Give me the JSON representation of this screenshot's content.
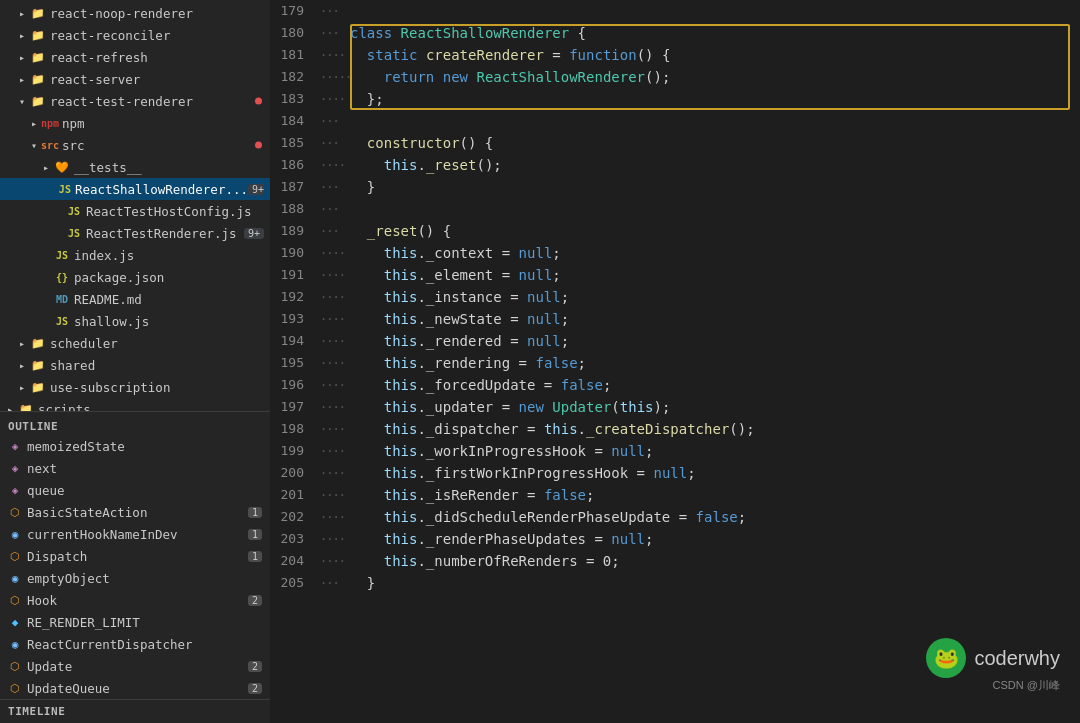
{
  "sidebar": {
    "file_tree": [
      {
        "id": "react-noop-renderer",
        "label": "react-noop-renderer",
        "indent": 1,
        "type": "folder",
        "state": "closed"
      },
      {
        "id": "react-reconciler",
        "label": "react-reconciler",
        "indent": 1,
        "type": "folder",
        "state": "closed"
      },
      {
        "id": "react-refresh",
        "label": "react-refresh",
        "indent": 1,
        "type": "folder",
        "state": "closed"
      },
      {
        "id": "react-server",
        "label": "react-server",
        "indent": 1,
        "type": "folder",
        "state": "closed"
      },
      {
        "id": "react-test-renderer",
        "label": "react-test-renderer",
        "indent": 1,
        "type": "folder",
        "state": "open",
        "dot": true
      },
      {
        "id": "npm",
        "label": "npm",
        "indent": 2,
        "type": "npm",
        "state": "closed"
      },
      {
        "id": "src",
        "label": "src",
        "indent": 2,
        "type": "src",
        "state": "open",
        "dot": true
      },
      {
        "id": "__tests__",
        "label": "__tests__",
        "indent": 3,
        "type": "test",
        "state": "closed"
      },
      {
        "id": "ReactShallowRenderer",
        "label": "ReactShallowRenderer...",
        "indent": 4,
        "type": "js",
        "state": "file",
        "badge": "9+",
        "active": true
      },
      {
        "id": "ReactTestHostConfig",
        "label": "ReactTestHostConfig.js",
        "indent": 4,
        "type": "js",
        "state": "file"
      },
      {
        "id": "ReactTestRenderer",
        "label": "ReactTestRenderer.js",
        "indent": 4,
        "type": "js",
        "state": "file",
        "badge": "9+"
      },
      {
        "id": "index.js",
        "label": "index.js",
        "indent": 3,
        "type": "js",
        "state": "file"
      },
      {
        "id": "package.json",
        "label": "package.json",
        "indent": 3,
        "type": "json",
        "state": "file"
      },
      {
        "id": "README.md",
        "label": "README.md",
        "indent": 3,
        "type": "md",
        "state": "file"
      },
      {
        "id": "shallow.js",
        "label": "shallow.js",
        "indent": 3,
        "type": "js",
        "state": "file"
      },
      {
        "id": "scheduler",
        "label": "scheduler",
        "indent": 1,
        "type": "folder",
        "state": "closed"
      },
      {
        "id": "shared",
        "label": "shared",
        "indent": 1,
        "type": "folder",
        "state": "closed"
      },
      {
        "id": "use-subscription",
        "label": "use-subscription",
        "indent": 1,
        "type": "folder",
        "state": "closed"
      },
      {
        "id": "scripts",
        "label": "scripts",
        "indent": 0,
        "type": "folder",
        "state": "closed"
      }
    ],
    "outline_label": "OUTLINE",
    "outline_items": [
      {
        "id": "memoizedState",
        "label": "memoizedState",
        "icon": "property"
      },
      {
        "id": "next",
        "label": "next",
        "icon": "property"
      },
      {
        "id": "queue",
        "label": "queue",
        "icon": "property"
      },
      {
        "id": "BasicStateAction",
        "label": "BasicStateAction",
        "icon": "class",
        "badge": "1"
      },
      {
        "id": "currentHookNameInDev",
        "label": "currentHookNameInDev",
        "icon": "var",
        "badge": "1"
      },
      {
        "id": "Dispatch",
        "label": "Dispatch",
        "icon": "class",
        "badge": "1"
      },
      {
        "id": "emptyObject",
        "label": "emptyObject",
        "icon": "var"
      },
      {
        "id": "Hook",
        "label": "Hook",
        "icon": "class",
        "badge": "2"
      },
      {
        "id": "RE_RENDER_LIMIT",
        "label": "RE_RENDER_LIMIT",
        "icon": "const"
      },
      {
        "id": "ReactCurrentDispatcher",
        "label": "ReactCurrentDispatcher",
        "icon": "var"
      },
      {
        "id": "Update",
        "label": "Update",
        "icon": "class",
        "badge": "2"
      },
      {
        "id": "UpdateQueue",
        "label": "UpdateQueue",
        "icon": "class",
        "badge": "2"
      }
    ],
    "timeline_label": "TIMELINE"
  },
  "code": {
    "lines": [
      {
        "num": 179,
        "dots": "···",
        "content": ""
      },
      {
        "num": 180,
        "dots": "···",
        "content": "class ReactShallowRenderer {",
        "highlight_start": true
      },
      {
        "num": 181,
        "dots": "····",
        "content": "  static createRenderer = function() {",
        "highlight": true
      },
      {
        "num": 182,
        "dots": "·····",
        "content": "    return new ReactShallowRenderer();",
        "highlight": true
      },
      {
        "num": 183,
        "dots": "····",
        "content": "  };",
        "highlight_end": true
      },
      {
        "num": 184,
        "dots": "···",
        "content": ""
      },
      {
        "num": 185,
        "dots": "···",
        "content": "  constructor() {"
      },
      {
        "num": 186,
        "dots": "····",
        "content": "    this._reset();"
      },
      {
        "num": 187,
        "dots": "···",
        "content": "  }"
      },
      {
        "num": 188,
        "dots": "···",
        "content": ""
      },
      {
        "num": 189,
        "dots": "···",
        "content": "  _reset() {"
      },
      {
        "num": 190,
        "dots": "····",
        "content": "    this._context = null;"
      },
      {
        "num": 191,
        "dots": "····",
        "content": "    this._element = null;"
      },
      {
        "num": 192,
        "dots": "····",
        "content": "    this._instance = null;"
      },
      {
        "num": 193,
        "dots": "····",
        "content": "    this._newState = null;"
      },
      {
        "num": 194,
        "dots": "····",
        "content": "    this._rendered = null;"
      },
      {
        "num": 195,
        "dots": "····",
        "content": "    this._rendering = false;"
      },
      {
        "num": 196,
        "dots": "····",
        "content": "    this._forcedUpdate = false;"
      },
      {
        "num": 197,
        "dots": "····",
        "content": "    this._updater = new Updater(this);"
      },
      {
        "num": 198,
        "dots": "····",
        "content": "    this._dispatcher = this._createDispatcher();"
      },
      {
        "num": 199,
        "dots": "····",
        "content": "    this._workInProgressHook = null;"
      },
      {
        "num": 200,
        "dots": "····",
        "content": "    this._firstWorkInProgressHook = null;"
      },
      {
        "num": 201,
        "dots": "····",
        "content": "    this._isReRender = false;"
      },
      {
        "num": 202,
        "dots": "····",
        "content": "    this._didScheduleRenderPhaseUpdate = false;"
      },
      {
        "num": 203,
        "dots": "····",
        "content": "    this._renderPhaseUpdates = null;"
      },
      {
        "num": 204,
        "dots": "····",
        "content": "    this._numberOfReRenders = 0;"
      },
      {
        "num": 205,
        "dots": "···",
        "content": "  }"
      }
    ]
  },
  "watermark": {
    "logo_char": "🐸",
    "brand": "coderwhy",
    "author": "CSDN @川峰"
  }
}
